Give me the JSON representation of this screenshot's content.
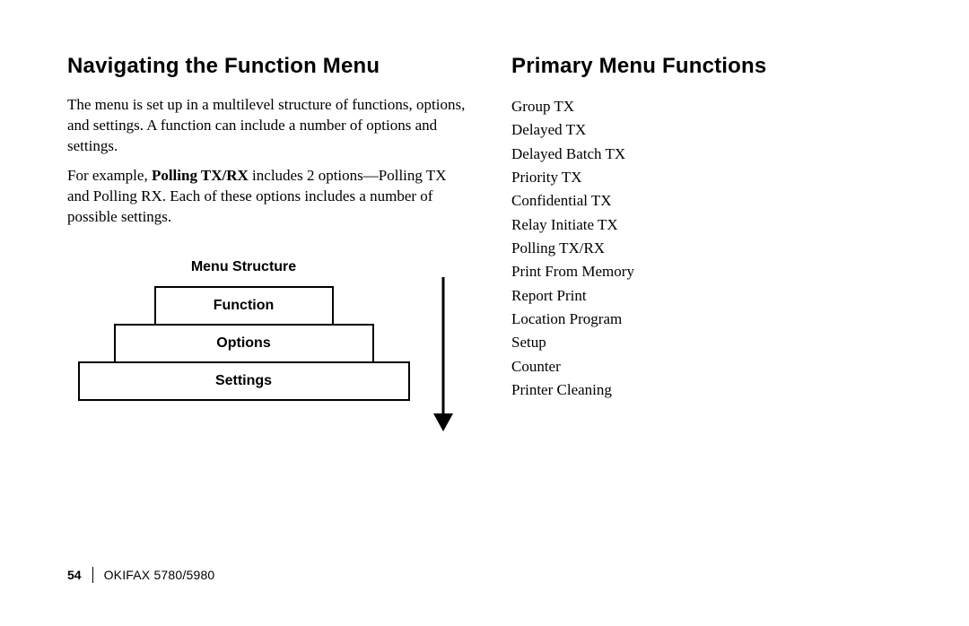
{
  "left": {
    "heading": "Navigating the Function Menu",
    "para1": "The menu is set up in a multilevel structure of functions, options, and settings. A function can include a number of options and settings.",
    "para2_prefix": "For example, ",
    "para2_bold": "Polling TX/RX",
    "para2_suffix": "  includes 2 options—Polling TX and Polling RX. Each of these options includes a number of possible settings.",
    "diagram": {
      "title": "Menu Structure",
      "tier1": "Function",
      "tier2": "Options",
      "tier3": "Settings"
    }
  },
  "right": {
    "heading": "Primary Menu Functions",
    "items": [
      "Group TX",
      "Delayed TX",
      "Delayed Batch TX",
      "Priority TX",
      "Confidential TX",
      "Relay Initiate TX",
      "Polling TX/RX",
      "Print From Memory",
      "Report Print",
      "Location Program",
      "Setup",
      "Counter",
      "Printer Cleaning"
    ]
  },
  "footer": {
    "page": "54",
    "model": "OKIFAX 5780/5980"
  }
}
